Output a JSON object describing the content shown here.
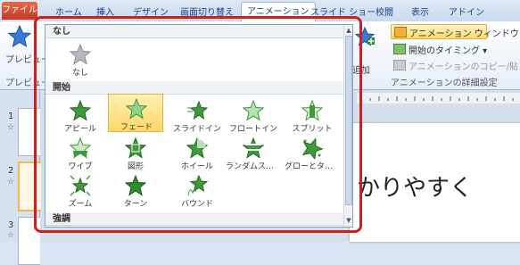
{
  "ribbon_tabs": {
    "file": "ファイル",
    "home": "ホーム",
    "insert": "挿入",
    "design": "デザイン",
    "transitions": "画面切り替え",
    "animations": "アニメーション",
    "slideshow": "スライド ショー",
    "review": "校閲",
    "view": "表示",
    "addin": "アドイン"
  },
  "ribbon": {
    "preview_label": "プレビュー",
    "preview_group": "プレビュー",
    "add_animation_label": "追加",
    "animation_window": "アニメーション ウィンドウ",
    "timing_start": "開始のタイミング",
    "painter": "アニメーションのコピー/貼り付け",
    "advanced_group": "アニメーションの詳細設定"
  },
  "gallery": {
    "section_none": "なし",
    "section_entrance": "開始",
    "section_emphasis": "強調",
    "none_item": "なし",
    "entrance_items": [
      "アピール",
      "フェード",
      "スライドイン",
      "フロートイン",
      "スプリット",
      "ワイプ",
      "図形",
      "ホイール",
      "ランダムストライプ",
      "グローとターン",
      "ズーム",
      "ターン",
      "バウンド"
    ],
    "selected_item": "フェード"
  },
  "slides": {
    "numbers": [
      "1",
      "2",
      "3"
    ],
    "star": "☆"
  },
  "slide_text": "かりやすく",
  "colors": {
    "accent_green": "#3e9a3a",
    "highlight_red": "#d11f1f",
    "selected_fill": "#ffd766",
    "file_tab": "#c0392b"
  }
}
